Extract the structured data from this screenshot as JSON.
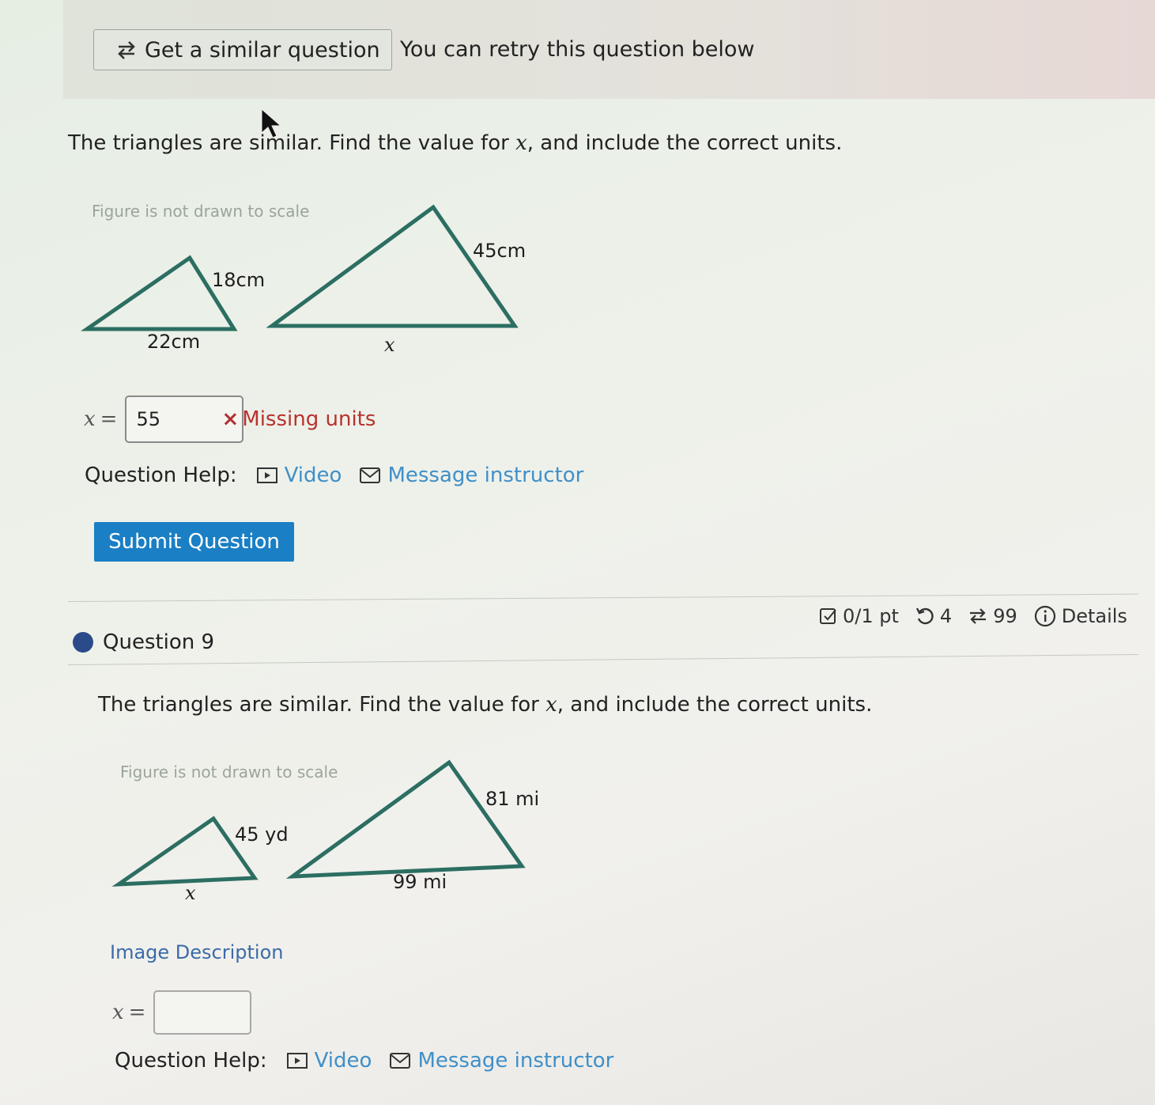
{
  "topbar": {
    "similar_button": "Get a similar question",
    "retry_text": "You can retry this question below"
  },
  "question8": {
    "prompt_before": "The triangles are similar. Find the value for ",
    "prompt_var": "x",
    "prompt_after": ", and include the correct units.",
    "figure_note": "Figure is not drawn to scale",
    "small_side": "18cm",
    "small_base": "22cm",
    "large_side": "45cm",
    "large_base": "x",
    "answer_var": "x",
    "answer_eq": "=",
    "answer_value": "55",
    "error_mark": "×",
    "error_text": "Missing units",
    "help_label": "Question Help:",
    "help_video": "Video",
    "help_message": "Message instructor",
    "submit_label": "Submit Question"
  },
  "question9": {
    "title": "Question 9",
    "points": "0/1 pt",
    "retries": "4",
    "attempts": "99",
    "details": "Details",
    "prompt_before": "The triangles are similar. Find the value for ",
    "prompt_var": "x",
    "prompt_after": ", and include the correct units.",
    "figure_note": "Figure is not drawn to scale",
    "small_side": "45 yd",
    "small_base": "x",
    "large_side": "81 mi",
    "large_base": "99 mi",
    "image_description": "Image Description",
    "answer_var": "x",
    "answer_eq": "=",
    "answer_value": "",
    "help_label": "Question Help:",
    "help_video": "Video",
    "help_message": "Message instructor"
  },
  "colors": {
    "triangle_stroke": "#2c6e62",
    "link": "#3f8fc9",
    "submit_bg": "#1a7fc4",
    "error": "#b8322e",
    "question_dot": "#2b4a8a"
  }
}
